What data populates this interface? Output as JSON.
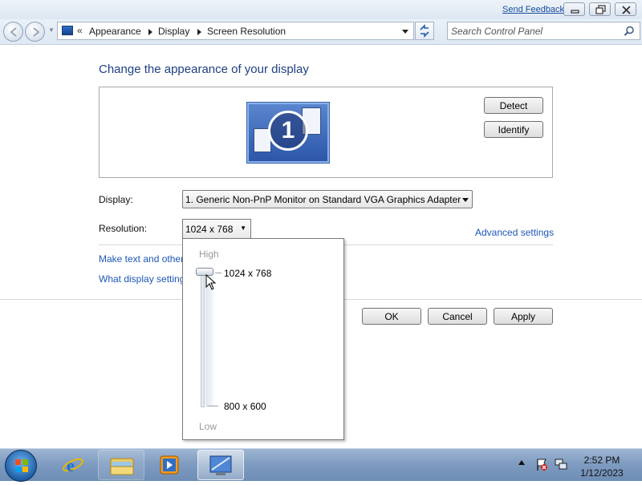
{
  "titlebar": {
    "feedback_link": "Send Feedback"
  },
  "navbar": {
    "address_prefix": "«",
    "breadcrumbs": [
      "Appearance",
      "Display",
      "Screen Resolution"
    ],
    "search_placeholder": "Search Control Panel"
  },
  "main": {
    "title": "Change the appearance of your display",
    "monitor_number": "1",
    "detect_button": "Detect",
    "identify_button": "Identify",
    "display_label": "Display:",
    "display_value": "1. Generic Non-PnP Monitor on Standard VGA Graphics Adapter",
    "resolution_label": "Resolution:",
    "resolution_value": "1024 x 768",
    "advanced_link": "Advanced settings",
    "link_text_size": "Make text and other",
    "link_display_settings": "What display setting",
    "ok_button": "OK",
    "cancel_button": "Cancel",
    "apply_button": "Apply"
  },
  "resolution_popup": {
    "high_label": "High",
    "low_label": "Low",
    "max_option": "1024 x 768",
    "min_option": "800 x 600",
    "selected": "1024 x 768"
  },
  "taskbar": {
    "time": "2:52 PM",
    "date": "1/12/2023",
    "items": [
      "start-orb",
      "internet-explorer",
      "windows-explorer",
      "media-player",
      "control-panel"
    ]
  },
  "colors": {
    "title_blue": "#1e3f84",
    "link_blue": "#1e57b7",
    "taskbar": "#7f9cc1"
  }
}
